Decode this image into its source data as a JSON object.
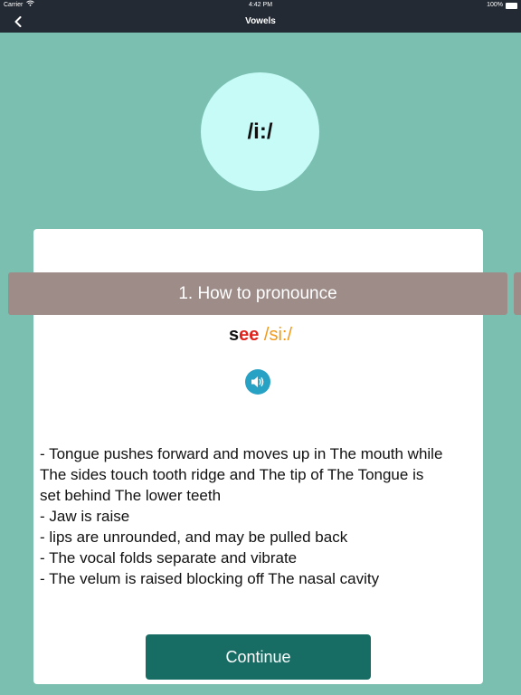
{
  "status_bar": {
    "carrier": "Carrier",
    "time": "4:42 PM",
    "battery": "100%"
  },
  "nav": {
    "back_icon": "chevron-left-icon",
    "title": "Vowels"
  },
  "phoneme": "/i:/",
  "section": {
    "header": "1. How to pronounce"
  },
  "example": {
    "word_prefix": "s",
    "word_highlight": "ee",
    "ipa": "/si:/",
    "colors": {
      "highlight": "#e0241d",
      "ipa": "#f39a17"
    }
  },
  "sound_button_icon": "speaker-icon",
  "description": {
    "lines": [
      "- Tongue pushes forward and moves up in The mouth while",
      "The sides touch tooth ridge and The tip of The Tongue is",
      "set behind The lower teeth",
      "- Jaw is raise",
      "- lips are unrounded, and may be pulled back",
      "- The vocal folds separate and vibrate",
      "- The velum is raised blocking off The nasal cavity"
    ]
  },
  "continue_label": "Continue",
  "colors": {
    "background": "#7bbfb0",
    "nav_bar": "#232a33",
    "phoneme_circle": "#c6fbf7",
    "section_header": "#9e8c89",
    "sound_button": "#27a1c4",
    "continue_button": "#176d64"
  }
}
